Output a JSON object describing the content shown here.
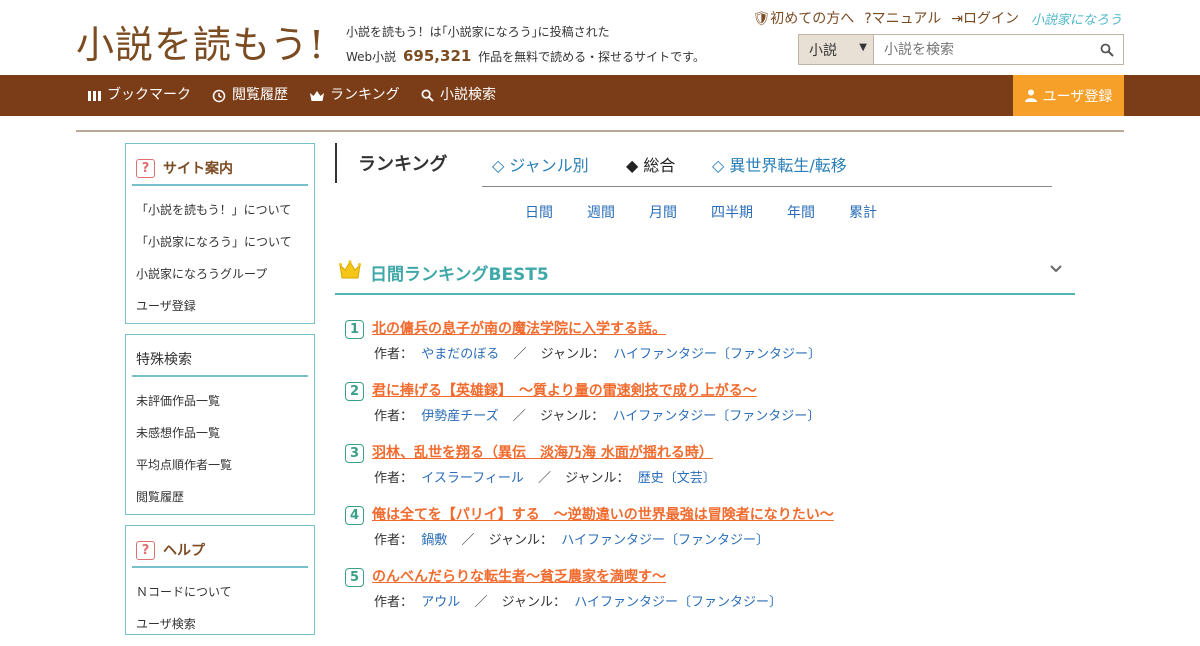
{
  "header": {
    "logo_text": "小説を読もう!",
    "tagline_line1": "小説を読もう！は｢小説家になろう｣に投稿された",
    "tagline_prefix": "Web小説",
    "tagline_count": "695,321",
    "tagline_suffix": "作品を無料で読める・探せるサイトです。",
    "links": [
      "初めての方へ",
      "マニュアル",
      "ログイン"
    ],
    "brand_link": "小説家になろう",
    "search": {
      "select_value": "小説",
      "placeholder": "小説を検索"
    }
  },
  "nav": {
    "items": [
      "ブックマーク",
      "閲覧履歴",
      "ランキング",
      "小説検索"
    ],
    "register": "ユーザ登録"
  },
  "sidebar": {
    "site_guide": {
      "title": "サイト案内",
      "items": [
        "「小説を読もう！」について",
        "「小説家になろう」について",
        "小説家になろうグループ",
        "ユーザ登録"
      ]
    },
    "special_search": {
      "title": "特殊検索",
      "items": [
        "未評価作品一覧",
        "未感想作品一覧",
        "平均点順作者一覧",
        "閲覧履歴"
      ]
    },
    "help": {
      "title": "ヘルプ",
      "items": [
        "Ｎコードについて",
        "ユーザ検索"
      ]
    }
  },
  "ranking": {
    "title": "ランキング",
    "tabs": [
      "◇ ジャンル別",
      "◆ 総合",
      "◇ 異世界転生/転移"
    ],
    "periods": [
      "日間",
      "週間",
      "月間",
      "四半期",
      "年間",
      "累計"
    ],
    "best_title": "日間ランキングBEST5",
    "author_label": "作者：",
    "genre_label": "ジャンル：",
    "separator": "／",
    "entries": [
      {
        "rank": "1",
        "title": "北の傭兵の息子が南の魔法学院に入学する話。",
        "author": "やまだのぼる",
        "genre": "ハイファンタジー〔ファンタジー〕"
      },
      {
        "rank": "2",
        "title": "君に捧げる【英雄録】　～質より量の雷速剣技で成り上がる～",
        "author": "伊勢産チーズ",
        "genre": "ハイファンタジー〔ファンタジー〕"
      },
      {
        "rank": "3",
        "title": "羽林、乱世を翔る（異伝　淡海乃海 水面が揺れる時）",
        "author": "イスラーフィール",
        "genre": "歴史〔文芸〕"
      },
      {
        "rank": "4",
        "title": "俺は全てを【パリイ】する　～逆勘違いの世界最強は冒険者になりたい～",
        "author": "鍋敷",
        "genre": "ハイファンタジー〔ファンタジー〕"
      },
      {
        "rank": "5",
        "title": "のんべんだらりな転生者～貧乏農家を満喫す～",
        "author": "アウル",
        "genre": "ハイファンタジー〔ファンタジー〕"
      }
    ]
  },
  "colors": {
    "brown": "#7b3d18",
    "orange": "#f6a02a",
    "teal": "#53b6b6",
    "link_orange": "#f26b2e"
  }
}
